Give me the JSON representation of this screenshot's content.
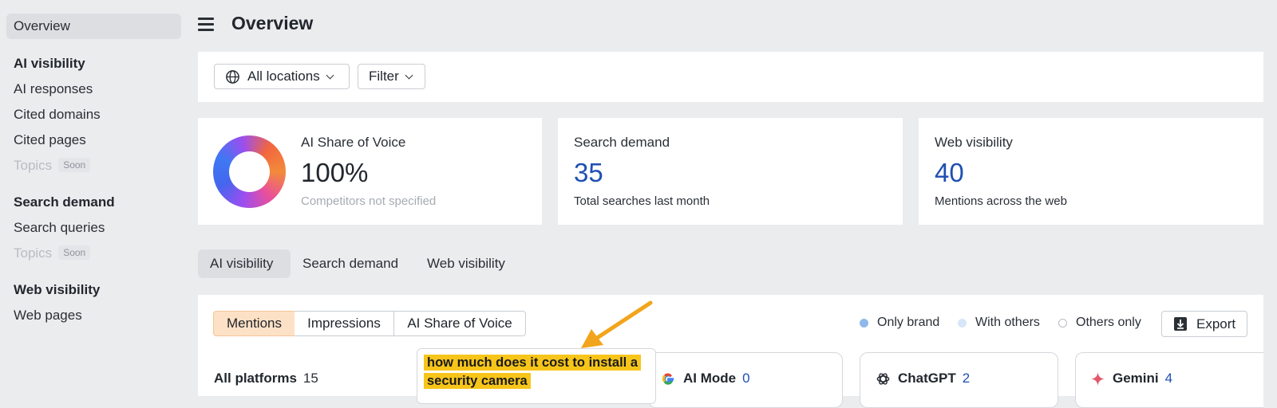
{
  "sidebar": {
    "overview": "Overview",
    "ai_visibility": {
      "heading": "AI visibility",
      "items": [
        "AI responses",
        "Cited domains",
        "Cited pages"
      ],
      "topics": "Topics",
      "topics_badge": "Soon"
    },
    "search_demand": {
      "heading": "Search demand",
      "items": [
        "Search queries"
      ],
      "topics": "Topics",
      "topics_badge": "Soon"
    },
    "web_visibility": {
      "heading": "Web visibility",
      "items": [
        "Web pages"
      ]
    }
  },
  "header": {
    "title": "Overview"
  },
  "filters": {
    "locations": "All locations",
    "filter": "Filter"
  },
  "cards": {
    "share_of_voice": {
      "label": "AI Share of Voice",
      "value": "100%",
      "sub": "Competitors not specified"
    },
    "search_demand": {
      "label": "Search demand",
      "value": "35",
      "sub": "Total searches last month"
    },
    "web_visibility": {
      "label": "Web visibility",
      "value": "40",
      "sub": "Mentions across the web"
    }
  },
  "tabs": [
    "AI visibility",
    "Search demand",
    "Web visibility"
  ],
  "segments": [
    "Mentions",
    "Impressions",
    "AI Share of Voice"
  ],
  "legend": [
    "Only brand",
    "With others",
    "Others only"
  ],
  "export_label": "Export",
  "platforms": {
    "all": {
      "name": "All platforms",
      "count": "15"
    },
    "ai_mode": {
      "name": "AI Mode",
      "count": "0"
    },
    "chatgpt": {
      "name": "ChatGPT",
      "count": "2"
    },
    "gemini": {
      "name": "Gemini",
      "count": "4"
    }
  },
  "tooltip": {
    "text_line1": "how much does it cost to install a",
    "text_line2": "security camera"
  },
  "colors": {
    "accent_blue": "#1f4fb3",
    "active_segment": "#fde1c6",
    "highlight": "#f7c51a",
    "arrow": "#f2a51c"
  }
}
